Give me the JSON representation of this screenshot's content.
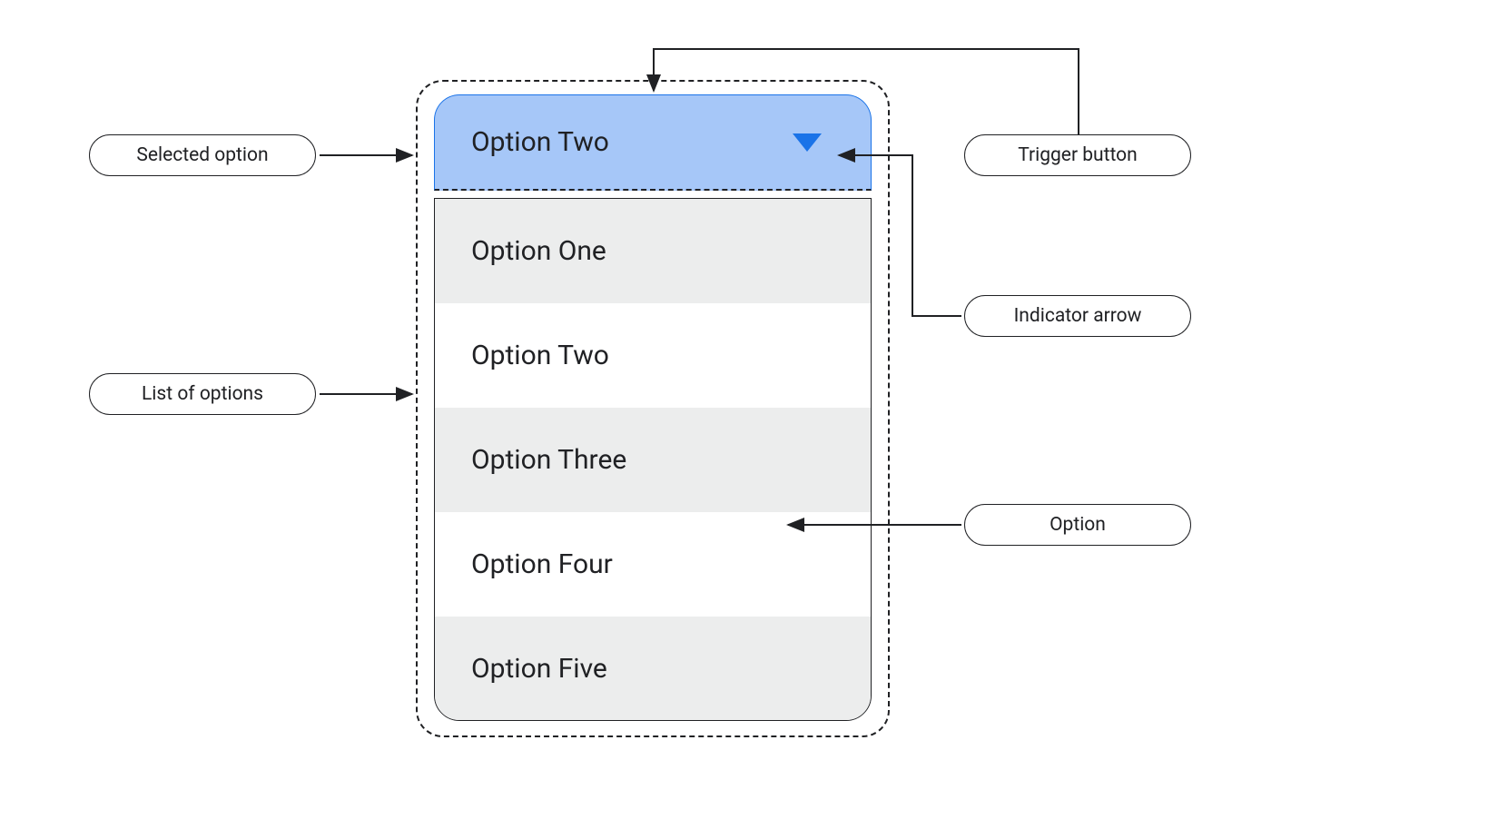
{
  "dropdown": {
    "selected": "Option Two",
    "options": [
      "Option One",
      "Option Two",
      "Option Three",
      "Option  Four",
      "Option Five"
    ]
  },
  "annotations": {
    "selected_option": "Selected option",
    "list_of_options": "List of options",
    "trigger_button": "Trigger button",
    "indicator_arrow": "Indicator arrow",
    "option": "Option"
  },
  "colors": {
    "trigger_bg": "#a6c7f8",
    "trigger_border": "#1a73e8",
    "option_grey": "#eceded",
    "stroke": "#202124"
  }
}
